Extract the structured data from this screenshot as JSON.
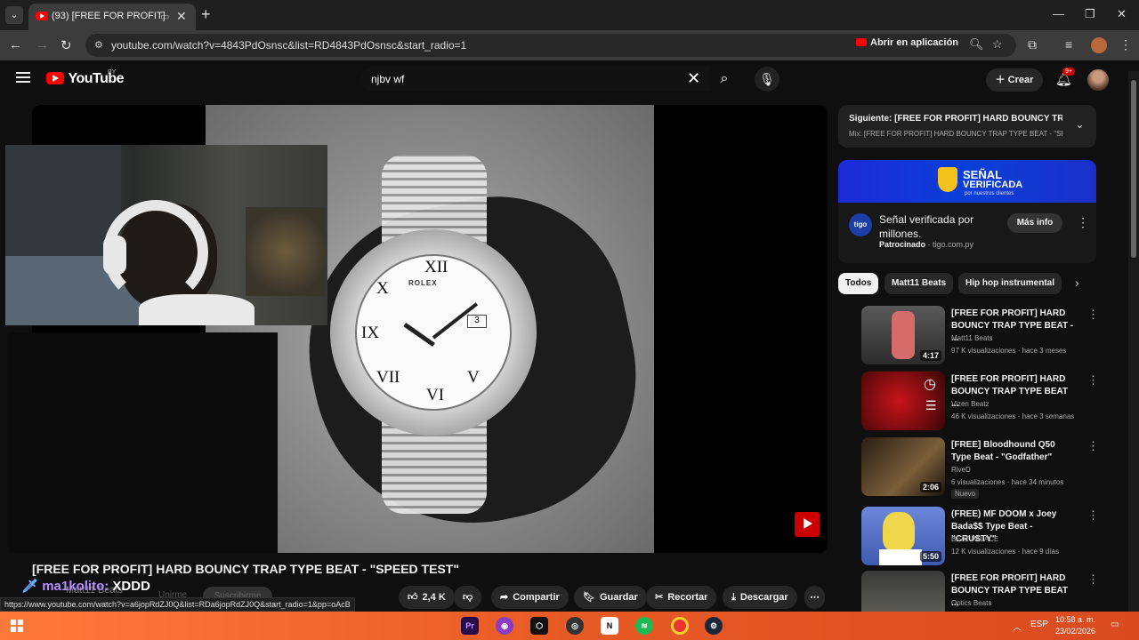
{
  "browser": {
    "tab_title": "(93) [FREE FOR PROFIT] HARD BOUNCY TRAP TYPE BEAT",
    "tab_media_icon": "media-playing-icon",
    "new_tab_label": "+",
    "url": "youtube.com/watch?v=4843PdOsnsc&list=RD4843PdOsnsc&start_radio=1",
    "open_app_label": "Abrir en aplicación",
    "status_url": "https://www.youtube.com/watch?v=a6jopRdZJ0Q&list=RDa6jopRdZJ0Q&start_radio=1&pp=oAcB"
  },
  "youtube": {
    "logo_text": "YouTube",
    "country_code": "PY",
    "search_query": "njbv wf",
    "create_label": "Crear",
    "notif_badge": "9+"
  },
  "player": {
    "watch_brand": "ROLEX",
    "date_window": "3",
    "video_title": "[FREE FOR PROFIT] HARD BOUNCY TRAP TYPE BEAT - \"SPEED TEST\"",
    "channel_ghost": "Matt11 Beats",
    "join_ghost": "Unirme",
    "subscribe_ghost": "Suscribirme",
    "chat_user": "ma1kolito:",
    "chat_message": "XDDD"
  },
  "actions": {
    "likes": "2,4 K",
    "share": "Compartir",
    "save": "Guardar",
    "clip": "Recortar",
    "download": "Descargar"
  },
  "sidebar": {
    "next_title": "Siguiente: [FREE FOR PROFIT] HARD BOUNCY TRA...",
    "next_sub": "Mix: [FREE FOR PROFIT] HARD BOUNCY TRAP TYPE BEAT - \"SPEED TEST\"",
    "ad": {
      "banner_line1": "SEÑAL",
      "banner_line2": "VERIFICADA",
      "banner_line3": "por nuestros clientes",
      "logo_text": "tigo",
      "text": "Señal verificada por millones.",
      "sponsored": "Patrocinado",
      "domain": "· tigo.com.py",
      "cta": "Más info"
    },
    "chips": [
      "Todos",
      "Matt11 Beats",
      "Hip hop instrumental"
    ],
    "recs": [
      {
        "title": "[FREE FOR PROFIT] HARD BOUNCY TRAP TYPE BEAT - ...",
        "channel": "Matt11 Beats",
        "meta": "97 K visualizaciones · hace 3 meses",
        "duration": "4:17",
        "thumb": "#3a3a3a"
      },
      {
        "title": "[FREE FOR PROFIT] HARD BOUNCY TRAP TYPE BEAT ...",
        "channel": "Vizen Beatz",
        "meta": "46 K visualizaciones · hace 3 semanas",
        "duration": "",
        "thumb": "#5a0b0b"
      },
      {
        "title": "[FREE] Bloodhound Q50 Type Beat - \"Godfather\"",
        "channel": "RiveD",
        "meta": "6 visualizaciones · hace 34 minutos",
        "duration": "2:06",
        "badge": "Nuevo",
        "thumb": "#4a3a28"
      },
      {
        "title": "(FREE) MF DOOM x Joey Bada$$ Type Beat - \"CRUSTY\"",
        "channel": "BEAT PALACE",
        "meta": "12 K visualizaciones · hace 9 días",
        "duration": "5:50",
        "thumb": "#3f5bb0"
      },
      {
        "title": "[FREE FOR PROFIT] HARD BOUNCY TRAP TYPE BEAT ...",
        "channel": "Optics Beats",
        "meta": "",
        "duration": "",
        "thumb": "#2e2e2e"
      }
    ]
  },
  "taskbar": {
    "lang": "ESP",
    "time": "10:58 a. m.",
    "date": "23/02/2026"
  }
}
